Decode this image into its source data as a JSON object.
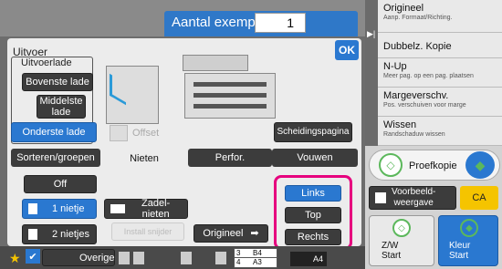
{
  "header": {
    "copies_label": "Aantal exempl.",
    "copies_value": "1"
  },
  "panel": {
    "title": "Uitvoer",
    "output_tray_label": "Uitvoerlade",
    "tray_buttons": [
      "Bovenste lade",
      "Middelste lade",
      "Onderste lade"
    ],
    "selected_tray": "Onderste lade",
    "offset_label": "Offset",
    "separator_page_label": "Scheidingspagina",
    "ok_label": "OK"
  },
  "tabs": [
    {
      "label": "Sorteren/groepen",
      "selected": false
    },
    {
      "label": "Nieten",
      "selected": true
    },
    {
      "label": "Perfor.",
      "selected": false
    },
    {
      "label": "Vouwen",
      "selected": false
    }
  ],
  "staple": {
    "off_label": "Off",
    "one_staple_label": "1 nietje",
    "two_staples_label": "2 nietjes",
    "saddle_label": "Zadel-\nnieten",
    "install_cutter_label": "Install snijder",
    "original_label": "Origineel",
    "position_options": [
      "Links",
      "Top",
      "Rechts"
    ],
    "selected_position": "Links",
    "selected_count": "1 nietje"
  },
  "paper_indicator": {
    "rows": [
      {
        "num": "3",
        "size": "B4"
      },
      {
        "num": "4",
        "size": "A3"
      }
    ],
    "current_size": "A4"
  },
  "bottom_bar": {
    "other_label": "Overige"
  },
  "right_menu": [
    {
      "title": "Origineel",
      "sub": "Aanp. Formaat/Richting."
    },
    {
      "title": "Dubbelz. Kopie",
      "sub": ""
    },
    {
      "title": "N-Up",
      "sub": "Meer pag. op een pag. plaatsen"
    },
    {
      "title": "Margeverschv.",
      "sub": "Pos. verschuiven voor marge"
    },
    {
      "title": "Wissen",
      "sub": "Randschaduw wissen"
    }
  ],
  "right_actions": {
    "proof_copy_label": "Proefkopie",
    "preview_label": "Voorbeeld-\nweergave",
    "ca_label": "CA",
    "bw_start_label": "Z/W\nStart",
    "color_start_label": "Kleur\nStart"
  },
  "colors": {
    "accent_blue": "#2a78d0",
    "highlight_magenta": "#e6007e",
    "start_green": "#5cb85c",
    "ca_yellow": "#f5c400"
  }
}
